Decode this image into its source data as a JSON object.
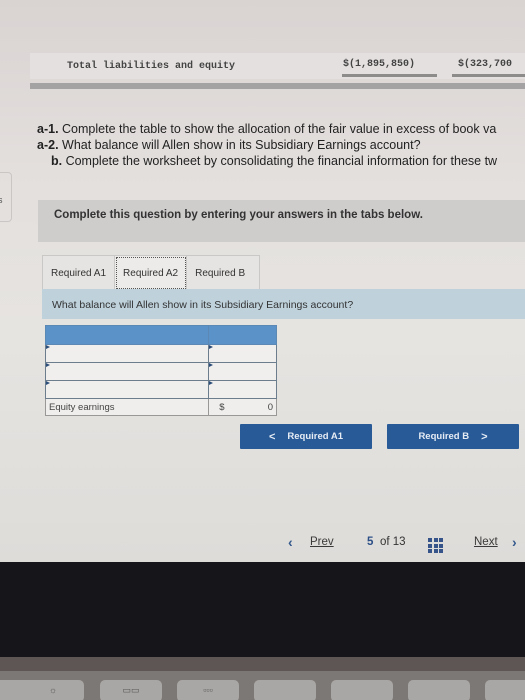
{
  "balance_sheet": {
    "label": "Total liabilities and equity",
    "value_1": "$(1,895,850)",
    "value_2": "$(323,700"
  },
  "questions": [
    {
      "prefix": "a-1.",
      "text": " Complete the table to show the allocation of the fair value in excess of book va"
    },
    {
      "prefix": "a-2.",
      "text": " What balance will Allen show in its Subsidiary Earnings account?"
    },
    {
      "prefix": "b.",
      "text": " Complete the worksheet by consolidating the financial information for these tw"
    }
  ],
  "side_tab": {
    "label": "s"
  },
  "instruction": "Complete this question by entering your answers in the tabs below.",
  "tabs": [
    {
      "label": "Required A1",
      "active": false
    },
    {
      "label": "Required A2",
      "active": true
    },
    {
      "label": "Required B",
      "active": false
    }
  ],
  "question_prompt": "What balance will Allen show in its Subsidiary Earnings account?",
  "answer_table": {
    "header": [
      "",
      ""
    ],
    "rows": [
      {
        "label": "",
        "value": ""
      },
      {
        "label": "",
        "value": ""
      },
      {
        "label": "",
        "value": ""
      }
    ],
    "total": {
      "label": "Equity earnings",
      "currency": "$",
      "value": "0"
    }
  },
  "nav_buttons": {
    "prev": {
      "label": "Required A1",
      "icon": "chevron-left"
    },
    "next": {
      "label": "Required B",
      "icon": "chevron-right"
    }
  },
  "pager": {
    "prev_label": "Prev",
    "current": "5",
    "of_label": "of 13",
    "next_label": "Next",
    "prev_icon": "‹",
    "next_icon": "›"
  },
  "keyboard": {
    "keys": [
      "brightness-icon",
      "mission-control-icon",
      "launchpad-icon",
      "",
      "",
      "",
      ""
    ],
    "glyphs": [
      "☼",
      "▭▭",
      "▫▫▫",
      "",
      "",
      "",
      ""
    ]
  }
}
